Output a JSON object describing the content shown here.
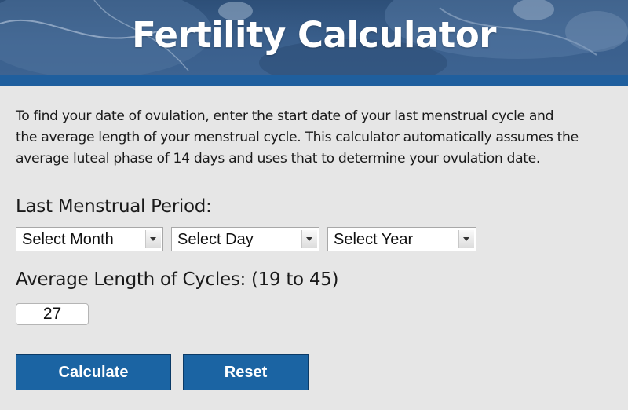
{
  "header": {
    "title": "Fertility Calculator"
  },
  "description": {
    "lines": [
      "To find your date of ovulation, enter the start date of your last menstrual cycle and",
      "the average length of your menstrual cycle. This calculator automatically assumes the",
      "average luteal phase of 14 days and uses that to determine your ovulation date."
    ]
  },
  "form": {
    "last_period_label": "Last Menstrual Period:",
    "month_select": "Select Month",
    "day_select": "Select Day",
    "year_select": "Select Year",
    "cycle_label": "Average Length of Cycles: (19 to 45)",
    "cycle_value": "27"
  },
  "buttons": {
    "calculate": "Calculate",
    "reset": "Reset"
  },
  "colors": {
    "banner": "#3a5f8c",
    "accent_strip": "#1f5f9e",
    "button": "#1b64a3",
    "background": "#e6e6e6"
  }
}
